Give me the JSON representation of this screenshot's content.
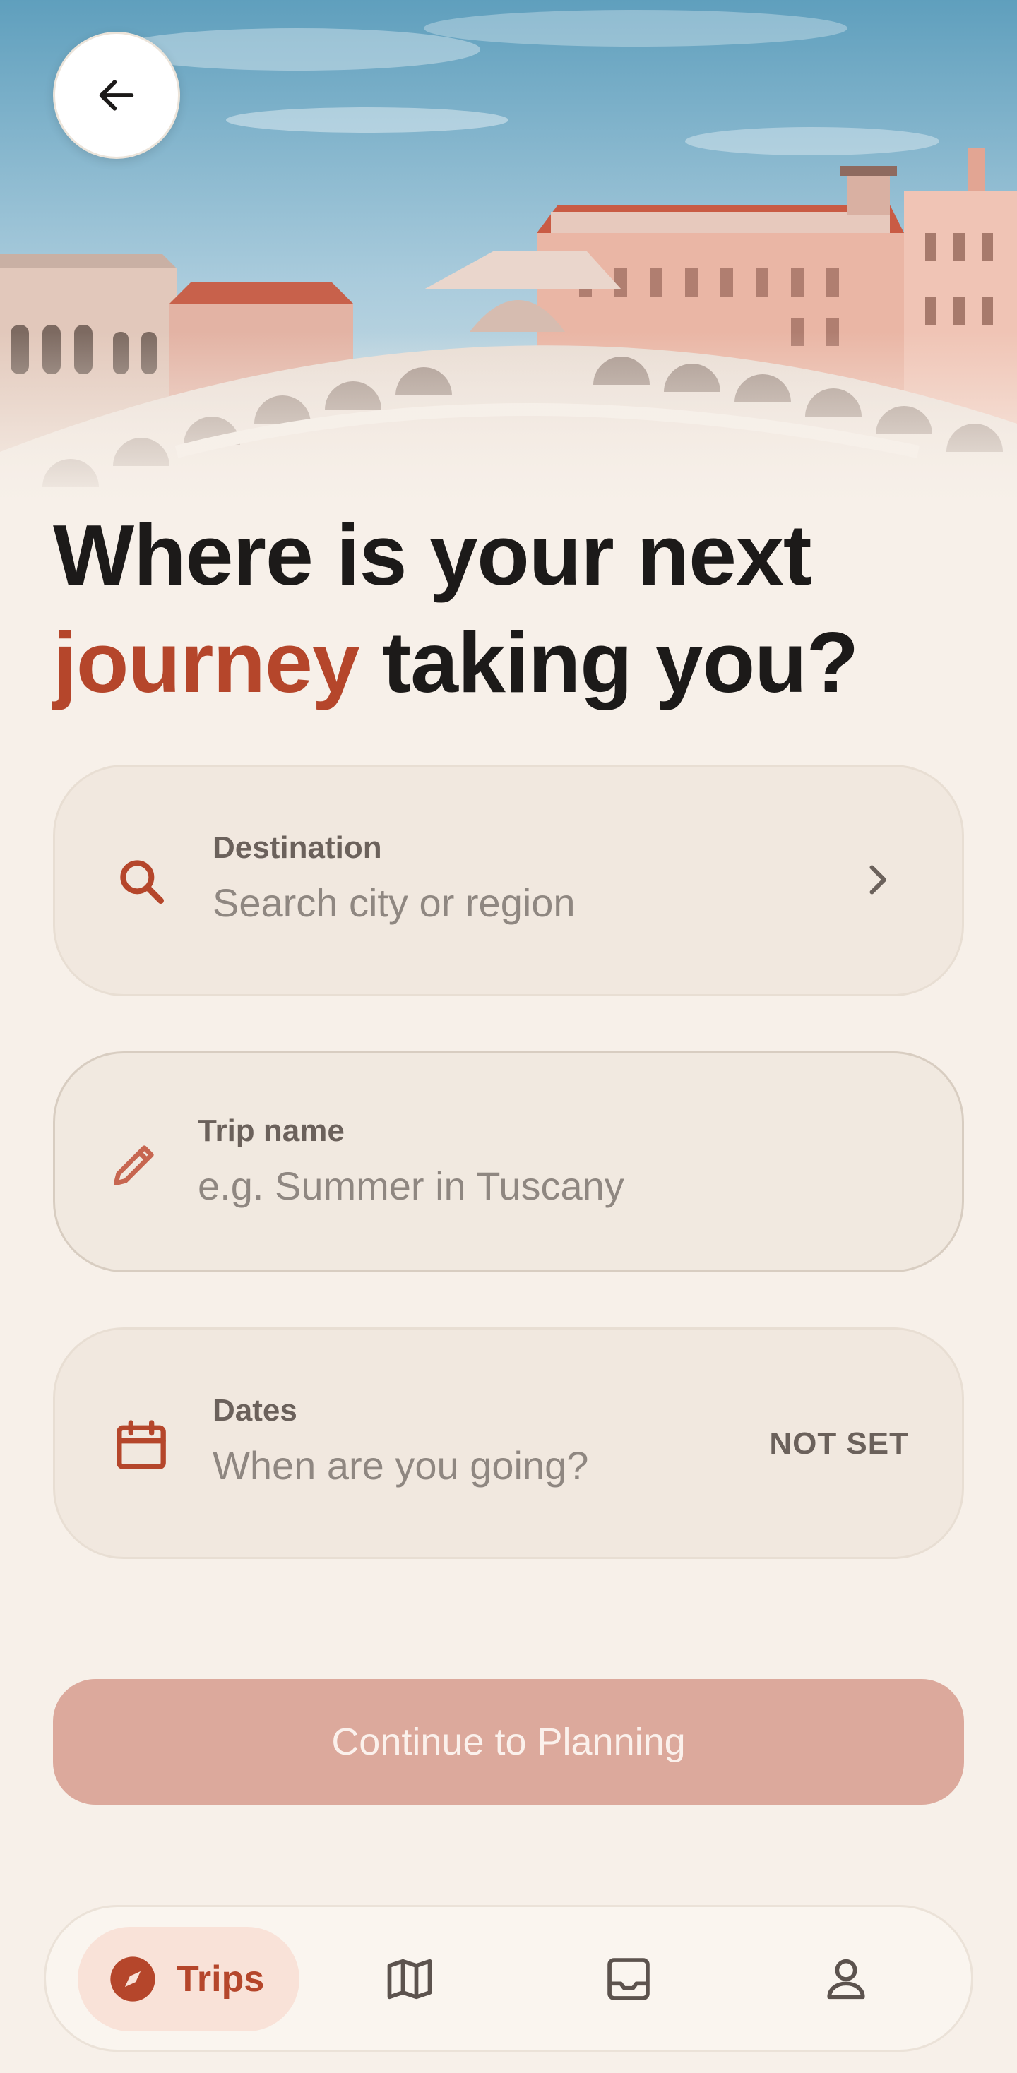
{
  "header": {
    "back_icon": "arrow-left-icon",
    "hero_image": "venice-rialto-bridge-photo"
  },
  "heading": {
    "line1": "Where is your next",
    "accent_word": "journey",
    "line2_rest": " taking you?"
  },
  "fields": {
    "destination": {
      "icon": "search-icon",
      "label": "Destination",
      "placeholder": "Search city or region",
      "trailing_icon": "chevron-right-icon"
    },
    "trip_name": {
      "icon": "pencil-icon",
      "label": "Trip name",
      "placeholder": "e.g. Summer in Tuscany"
    },
    "dates": {
      "icon": "calendar-icon",
      "label": "Dates",
      "placeholder": "When are you going?",
      "status": "NOT SET"
    }
  },
  "primary_button": {
    "label": "Continue to Planning",
    "state": "disabled"
  },
  "bottom_nav": {
    "items": [
      {
        "label": "Trips",
        "icon": "compass-icon",
        "active": true
      },
      {
        "label": "",
        "icon": "map-icon",
        "active": false
      },
      {
        "label": "",
        "icon": "inbox-icon",
        "active": false
      },
      {
        "label": "",
        "icon": "profile-icon",
        "active": false
      }
    ]
  },
  "colors": {
    "background": "#f7f0e9",
    "accent": "#b5462b",
    "card": "#f1e8df",
    "button_disabled": "#dca99c",
    "nav_active_bg": "#f9e2d8",
    "text_primary": "#1c1a19",
    "text_muted": "#8f8781"
  }
}
